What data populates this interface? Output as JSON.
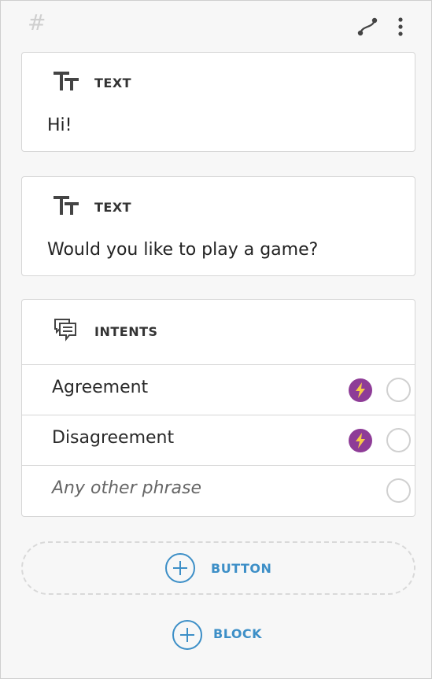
{
  "header": {
    "hash_symbol": "#"
  },
  "cards": {
    "text_1": {
      "type_label": "TEXT",
      "content": "Hi!"
    },
    "text_2": {
      "type_label": "TEXT",
      "content": "Would you like to play a game?"
    },
    "intents": {
      "type_label": "INTENTS",
      "rows": [
        {
          "label": "Agreement",
          "has_bolt": true
        },
        {
          "label": "Disagreement",
          "has_bolt": true
        },
        {
          "label": "Any other phrase",
          "has_bolt": false
        }
      ]
    }
  },
  "actions": {
    "add_button_label": "BUTTON",
    "add_block_label": "BLOCK"
  },
  "colors": {
    "accent_blue": "#3d8fc7",
    "bolt_purple": "#8e3c97",
    "bolt_yellow": "#f7c948"
  },
  "icons": [
    "hash-icon",
    "route-icon",
    "more-vertical-icon",
    "text-type-icon",
    "intents-icon",
    "bolt-icon",
    "plus-circle-icon"
  ]
}
